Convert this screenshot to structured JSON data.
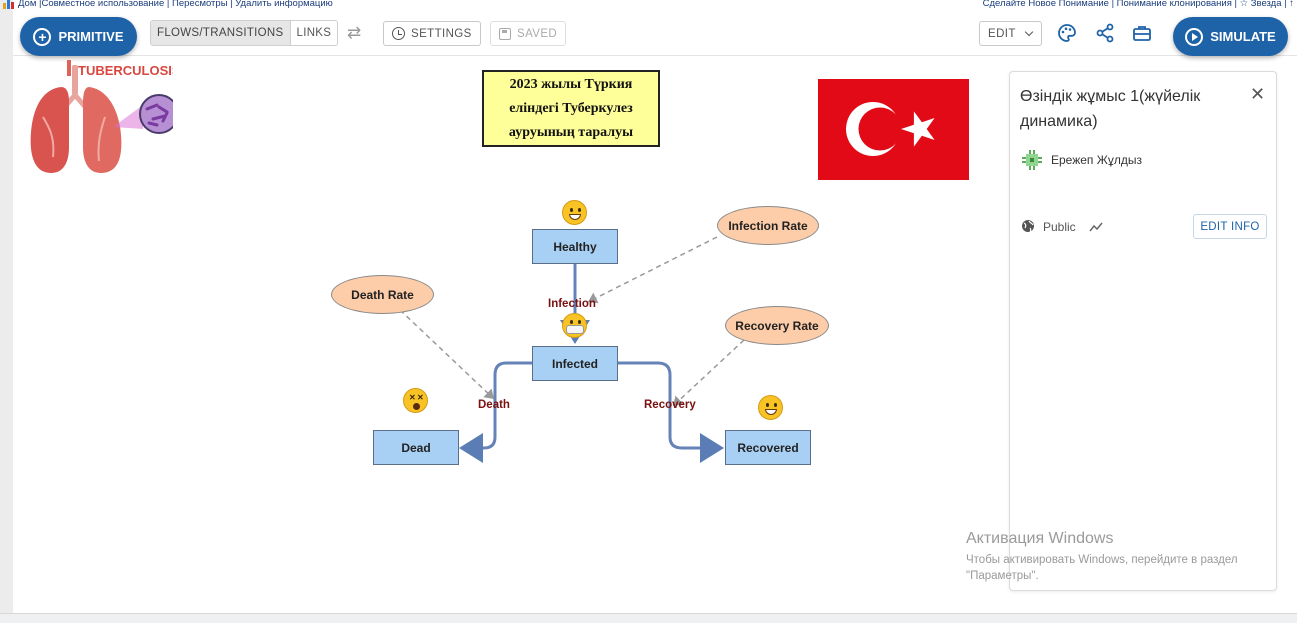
{
  "topbar": {
    "left_links": "Дом |Совместное использование | Пересмотры | Удалить информацию",
    "right_links": "Сделайте Новое Понимание | Понимание клонирования | ☆ Звезда | ↑"
  },
  "toolbar": {
    "primitive_label": "PRIMITIVE",
    "flows_label": "FLOWS/TRANSITIONS",
    "links_label": "LINKS",
    "settings_label": "SETTINGS",
    "saved_label": "SAVED",
    "edit_label": "EDIT",
    "simulate_label": "SIMULATE"
  },
  "canvas": {
    "title_lines": [
      "2023 жылы Түркия",
      "еліндегі Туберкулез",
      "ауруының таралуы"
    ],
    "image_caption": "TUBERCULOSIS",
    "stocks": {
      "healthy": "Healthy",
      "infected": "Infected",
      "dead": "Dead",
      "recovered": "Recovered"
    },
    "variables": {
      "infection_rate": "Infection Rate",
      "death_rate": "Death Rate",
      "recovery_rate": "Recovery Rate"
    },
    "flows": {
      "infection": "Infection",
      "death": "Death",
      "recovery": "Recovery"
    }
  },
  "panel": {
    "title": "Өзіндік жұмыс 1(жүйелік динамика)",
    "author": "Ережеп Жұлдыз",
    "visibility": "Public",
    "edit_info_label": "EDIT INFO"
  },
  "watermark": {
    "line1": "Активация Windows",
    "line2": "Чтобы активировать Windows, перейдите в раздел \"Параметры\"."
  },
  "colors": {
    "brand_blue": "#1e63a8",
    "stock_fill": "#a8d0f4",
    "variable_fill": "#fdcca8",
    "flow_label": "#7a1010",
    "flag_red": "#e30a17"
  },
  "icons": [
    "plus-circle-icon",
    "swap-icon",
    "clock-icon",
    "save-icon",
    "palette-icon",
    "share-icon",
    "briefcase-icon",
    "play-circle-icon",
    "close-icon",
    "globe-icon",
    "trend-icon",
    "author-avatar-icon"
  ]
}
